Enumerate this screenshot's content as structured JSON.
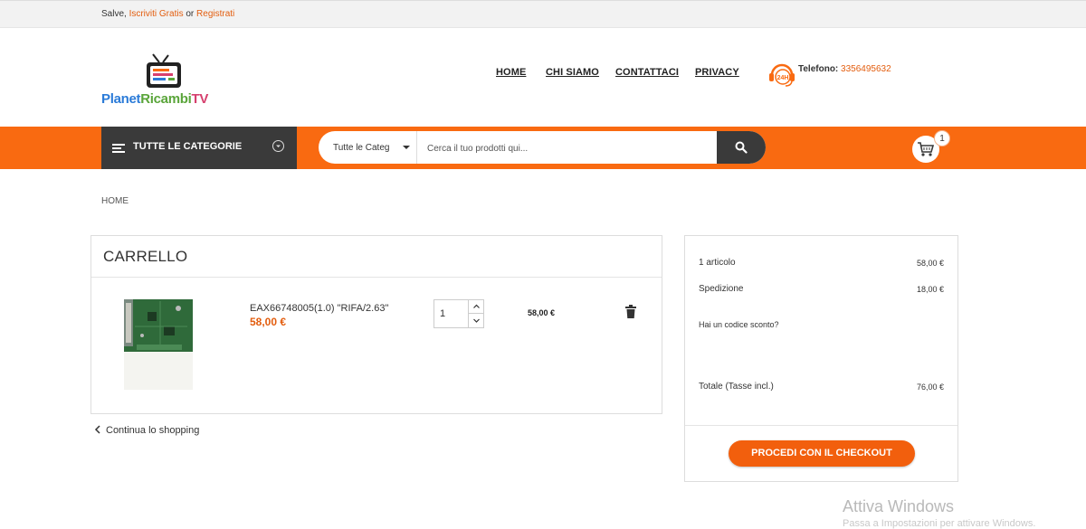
{
  "topbar": {
    "greeting": "Salve,",
    "signup_link": "Iscriviti Gratis",
    "or": "or",
    "register_link": "Registrati"
  },
  "logo": {
    "part1": "Planet",
    "part2": "Ricambi",
    "part3": "TV"
  },
  "nav": {
    "items": [
      {
        "label": "HOME"
      },
      {
        "label": "CHI SIAMO"
      },
      {
        "label": "CONTATTACI"
      },
      {
        "label": "PRIVACY"
      }
    ]
  },
  "phone": {
    "icon_text": "24H",
    "label": "Telefono:",
    "number": "3356495632"
  },
  "categories": {
    "label": "TUTTE LE CATEGORIE"
  },
  "search": {
    "category_selected": "Tutte le Categorie",
    "placeholder": "Cerca il tuo prodotti qui..."
  },
  "cart_badge": {
    "count": "1"
  },
  "breadcrumb": {
    "home": "HOME"
  },
  "cart": {
    "title": "CARRELLO",
    "items": [
      {
        "name": "EAX66748005(1.0) \"RIFA/2.63\"",
        "price": "58,00 €",
        "quantity": "1",
        "line_total": "58,00 €"
      }
    ],
    "continue_label": "Continua lo shopping"
  },
  "summary": {
    "items_label": "1 articolo",
    "items_amount": "58,00 €",
    "shipping_label": "Spedizione",
    "shipping_amount": "18,00 €",
    "discount_label": "Hai un codice sconto?",
    "total_label": "Totale (Tasse incl.)",
    "total_amount": "76,00 €",
    "checkout_label": "PROCEDI CON IL CHECKOUT"
  },
  "os_watermark": {
    "line1": "Attiva Windows",
    "line2": "Passa a Impostazioni per attivare Windows."
  },
  "colors": {
    "accent": "#f96a11",
    "dark": "#3a3a3a",
    "link": "#e35d0e"
  }
}
